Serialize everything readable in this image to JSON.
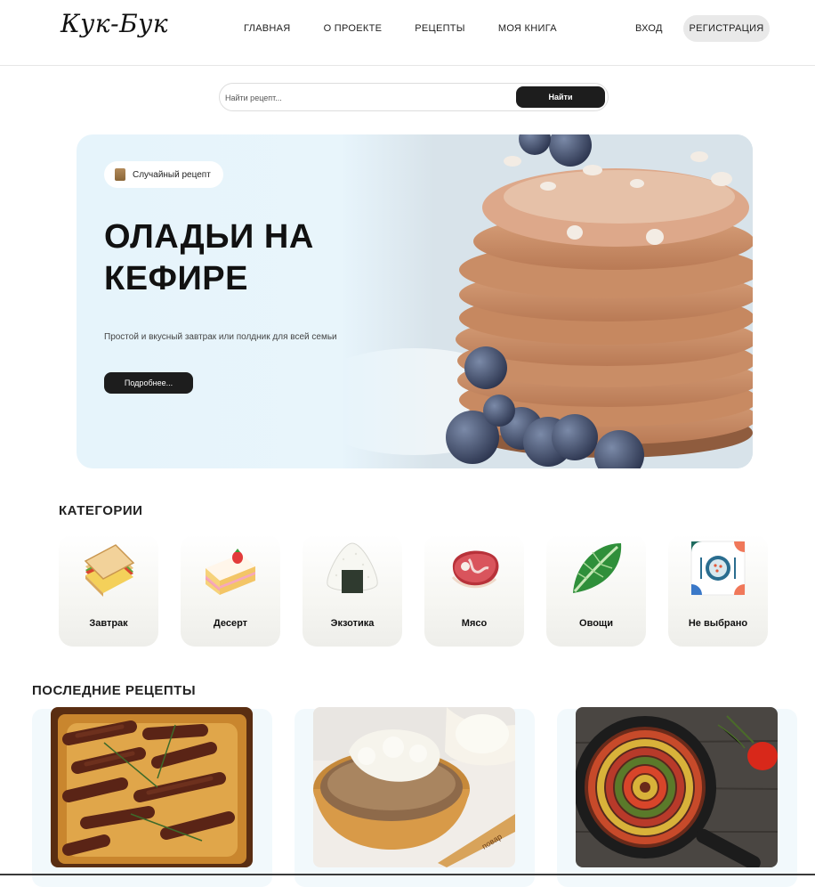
{
  "header": {
    "logo": "Кук-Бук",
    "nav": [
      {
        "label": "ГЛАВНАЯ"
      },
      {
        "label": "О ПРОЕКТЕ"
      },
      {
        "label": "РЕЦЕПТЫ"
      },
      {
        "label": "МОЯ КНИГА"
      }
    ],
    "login_label": "ВХОД",
    "register_label": "РЕГИСТРАЦИЯ"
  },
  "search": {
    "placeholder": "Найти рецепт...",
    "value": "",
    "button_label": "Найти"
  },
  "hero": {
    "badge_label": "Случайный рецепт",
    "badge_icon": "book-icon",
    "title": "ОЛАДЬИ НА КЕФИРЕ",
    "description": "Простой и вкусный завтрак или полдник для всей семьи",
    "button_label": "Подробнее..."
  },
  "categories": {
    "title": "КАТЕГОРИИ",
    "items": [
      {
        "label": "Завтрак",
        "icon": "sandwich-icon"
      },
      {
        "label": "Десерт",
        "icon": "cake-icon"
      },
      {
        "label": "Экзотика",
        "icon": "onigiri-icon"
      },
      {
        "label": "Мясо",
        "icon": "meat-icon"
      },
      {
        "label": "Овощи",
        "icon": "leafy-green-icon"
      },
      {
        "label": "Не выбрано",
        "icon": "plate-icon"
      }
    ]
  },
  "recent": {
    "title": "ПОСЛЕДНИЕ РЕЦЕПТЫ",
    "items": [
      {
        "image": "sausages-in-batter-photo"
      },
      {
        "image": "buckwheat-bowl-photo"
      },
      {
        "image": "ratatouille-pan-photo"
      }
    ]
  },
  "colors": {
    "accent_dark": "#1d1d1d",
    "hero_bg": "#e6f4fb",
    "register_bg": "#e9e9e9"
  }
}
